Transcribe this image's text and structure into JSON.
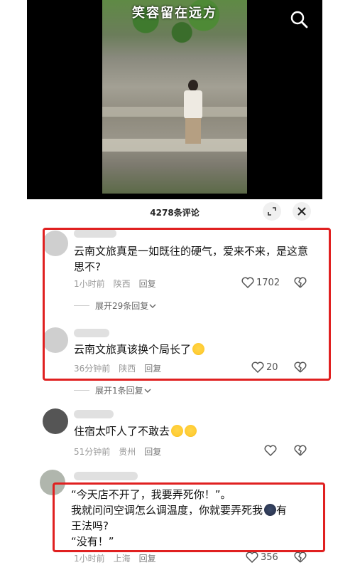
{
  "video": {
    "title": "笑容留在远方",
    "search_icon": "search-icon"
  },
  "comments_panel": {
    "title": "4278条评论",
    "expand_icon": "expand-icon",
    "close_icon": "close-icon"
  },
  "comments": [
    {
      "text": "云南文旅真是一如既往的硬气，爱来不来，是这意思不?",
      "time": "1小时前",
      "location": "陕西",
      "reply_label": "回复",
      "likes": "1702",
      "expand_label": "展开29条回复"
    },
    {
      "text": "云南文旅真该换个局长了",
      "emoji": "laughing-tears-emoji",
      "time": "36分钟前",
      "location": "陕西",
      "reply_label": "回复",
      "likes": "20",
      "expand_label": "展开1条回复"
    },
    {
      "text": "住宿太吓人了不敢去",
      "emoji": "thinking-emoji",
      "time": "51分钟前",
      "location": "贵州",
      "reply_label": "回复",
      "likes": ""
    },
    {
      "line1": "“今天店不开了，我要弄死你！”。",
      "line2": "我就问问空调怎么调温度，你就要弄死我",
      "line2_tail": "有",
      "line3": "王法吗?",
      "line4": "“没有！”",
      "emoji": "scared-emoji",
      "time": "1小时前",
      "location": "上海",
      "reply_label": "回复",
      "likes": "356"
    }
  ],
  "colors": {
    "highlight_box": "#e02020",
    "meta_text": "#999999"
  }
}
